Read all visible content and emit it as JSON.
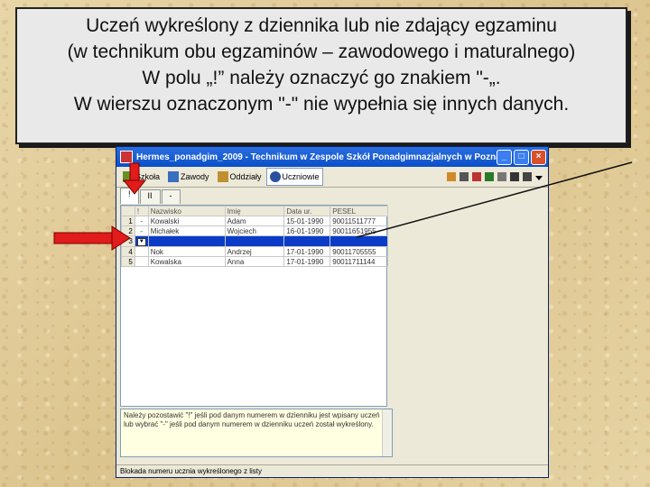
{
  "callout": {
    "lines": [
      "Uczeń wykreślony z dziennika lub nie zdający egzaminu",
      "(w technikum obu egzaminów – zawodowego i maturalnego)",
      "W polu „!” należy oznaczyć go znakiem \"-„.",
      "W wierszu oznaczonym \"-\" nie wypełnia się innych danych."
    ]
  },
  "window": {
    "title": "Hermes_ponadgim_2009 - Technikum w Zespole Szkół Ponadgimnazjalnych w Pozna...",
    "min_label": "_",
    "max_label": "□",
    "close_label": "×"
  },
  "toolbar": {
    "items": [
      "Szkoła",
      "Zawody",
      "Oddziały",
      "Uczniowie"
    ],
    "active": "Uczniowie"
  },
  "subtabs": [
    "!",
    "II",
    "-"
  ],
  "table": {
    "headers": [
      "",
      "!",
      "Nazwisko",
      "Imię",
      "Data ur.",
      "PESEL"
    ],
    "rows": [
      {
        "num": "1",
        "mark": "-",
        "surname": "Kowalski",
        "name": "Adam",
        "dob": "15-01-1990",
        "pesel": "90011511777"
      },
      {
        "num": "2",
        "mark": "-",
        "surname": "Michałek",
        "name": "Wojciech",
        "dob": "16-01-1990",
        "pesel": "90011651955"
      },
      {
        "num": "3",
        "mark": "",
        "surname": "",
        "name": "",
        "dob": "",
        "pesel": ""
      },
      {
        "num": "4",
        "mark": "",
        "surname": "Nok",
        "name": "Andrzej",
        "dob": "17-01-1990",
        "pesel": "90011705555"
      },
      {
        "num": "5",
        "mark": "",
        "surname": "Kowalska",
        "name": "Anna",
        "dob": "17-01-1990",
        "pesel": "90011711144"
      }
    ],
    "selected_row": "3"
  },
  "infobox": {
    "lines": [
      "Należy pozostawić \"!\" jeśli pod danym numerem w dzienniku jest wpisany uczeń",
      "lub wybrać \"-\" jeśli pod danym numerem w dzienniku uczeń został wykreślony."
    ]
  },
  "statusbar": {
    "text": "Blokada numeru ucznia wykreślonego z listy"
  },
  "colors": {
    "arrow": "#e21b1b",
    "selection": "#0a3cc8",
    "titlebar": "#0b4fc8"
  }
}
